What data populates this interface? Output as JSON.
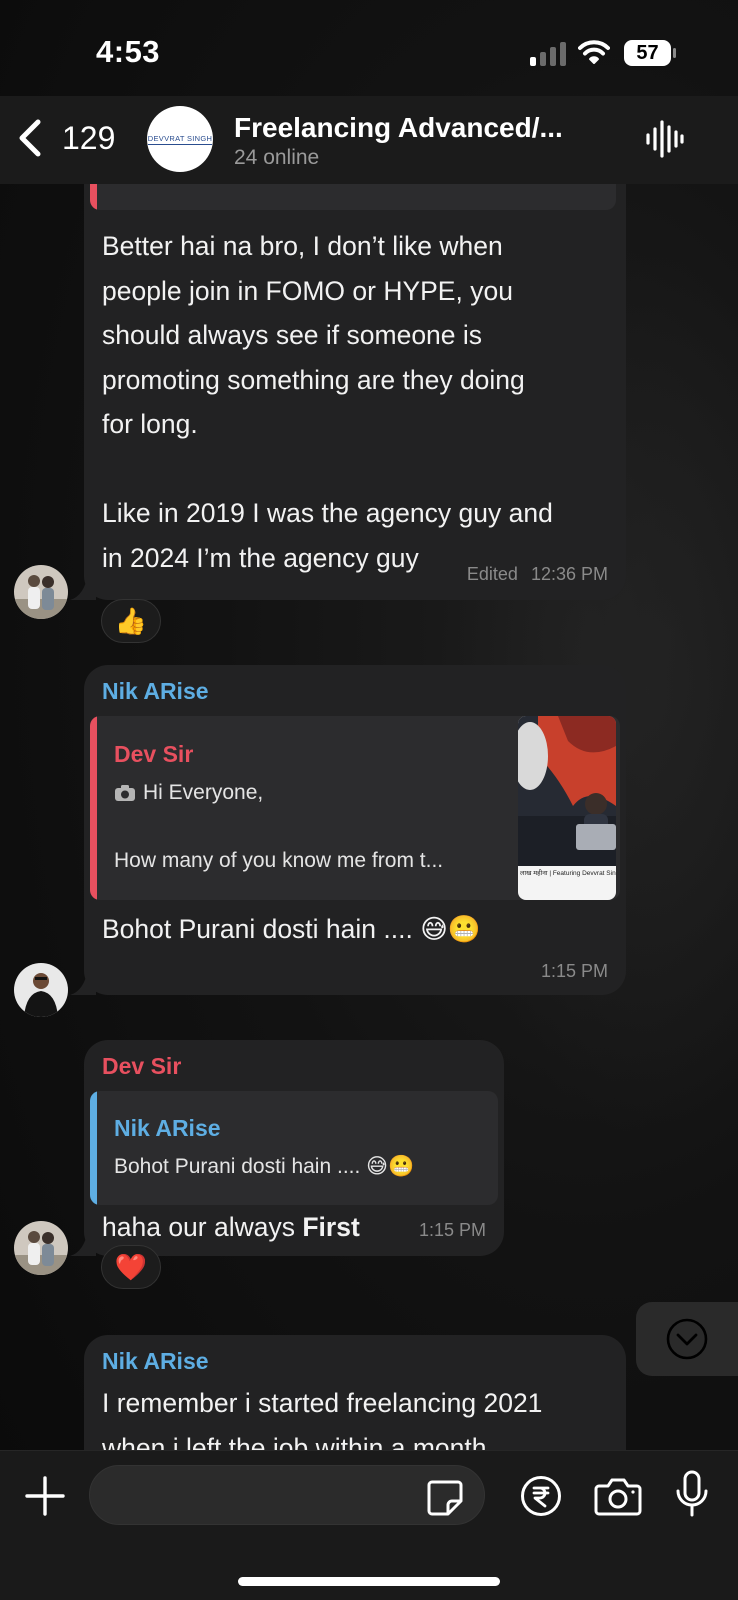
{
  "status_bar": {
    "time": "4:53",
    "battery": "57"
  },
  "header": {
    "back_count": "129",
    "group_avatar_text": "DEVVRAT SINGH",
    "title": "Freelancing Advanced/...",
    "subtitle": "24 online"
  },
  "messages": [
    {
      "text_lines": [
        "Better hai na bro, I don’t like when",
        "people join in FOMO or HYPE, you",
        "should always see if someone is",
        "promoting something are they doing",
        "for long.",
        "",
        "Like in 2019 I was the agency guy and",
        "in 2024 I’m the agency guy"
      ],
      "edited_label": "Edited",
      "time": "12:36 PM",
      "reaction": "👍"
    },
    {
      "sender": "Nik ARise",
      "reply": {
        "sender": "Dev Sir",
        "line1": "Hi Everyone,",
        "line2": "How many of you know me from t...",
        "thumb_caption": "लाख महीना | Featuring Devvrat Singh"
      },
      "text": "Bohot Purani dosti hain .... 😅😬",
      "time": "1:15 PM"
    },
    {
      "sender": "Dev Sir",
      "reply": {
        "sender": "Nik ARise",
        "line1": "Bohot Purani dosti hain .... 😅😬"
      },
      "text_plain": "haha our always ",
      "text_bold": "First",
      "time": "1:15 PM",
      "reaction": "❤️"
    },
    {
      "sender": "Nik ARise",
      "text_line1": "I remember i started freelancing 2021",
      "text_line2": "when i left the job within a month"
    }
  ],
  "colors": {
    "blue_sender": "#5eaee3",
    "red_sender": "#e8505f",
    "bubble": "#222223"
  }
}
